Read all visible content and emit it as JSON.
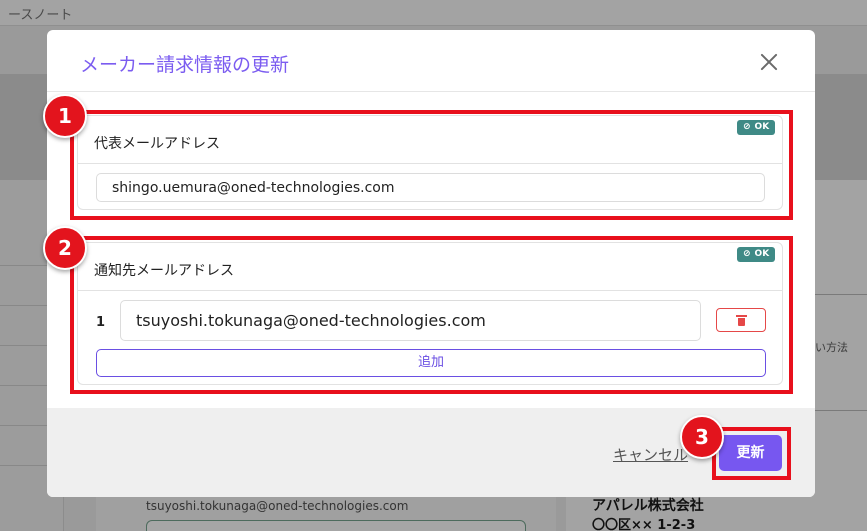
{
  "background": {
    "topbar_text": "ースノート",
    "right_snippet": "い方法",
    "email_text": "tsuyoshi.tokunaga@oned-technologies.com",
    "company_name": "アパレル株式会社",
    "address": "〇〇区×× 1-2-3"
  },
  "modal": {
    "title": "メーカー請求情報の更新",
    "close_icon": "close-icon",
    "representative": {
      "label": "代表メールアドレス",
      "badge": "OK",
      "email": "shingo.uemura@oned-technologies.com"
    },
    "notification": {
      "label": "通知先メールアドレス",
      "badge": "OK",
      "rows": [
        {
          "index": "1",
          "email": "tsuyoshi.tokunaga@oned-technologies.com"
        }
      ],
      "add_label": "追加"
    },
    "footer": {
      "cancel_label": "キャンセル",
      "update_label": "更新"
    }
  },
  "annotations": {
    "marker_1": "1",
    "marker_2": "2",
    "marker_3": "3",
    "color": "#e8101c"
  },
  "colors": {
    "accent": "#7757f0",
    "ok_badge": "#3f8a86",
    "danger": "#e54848"
  }
}
